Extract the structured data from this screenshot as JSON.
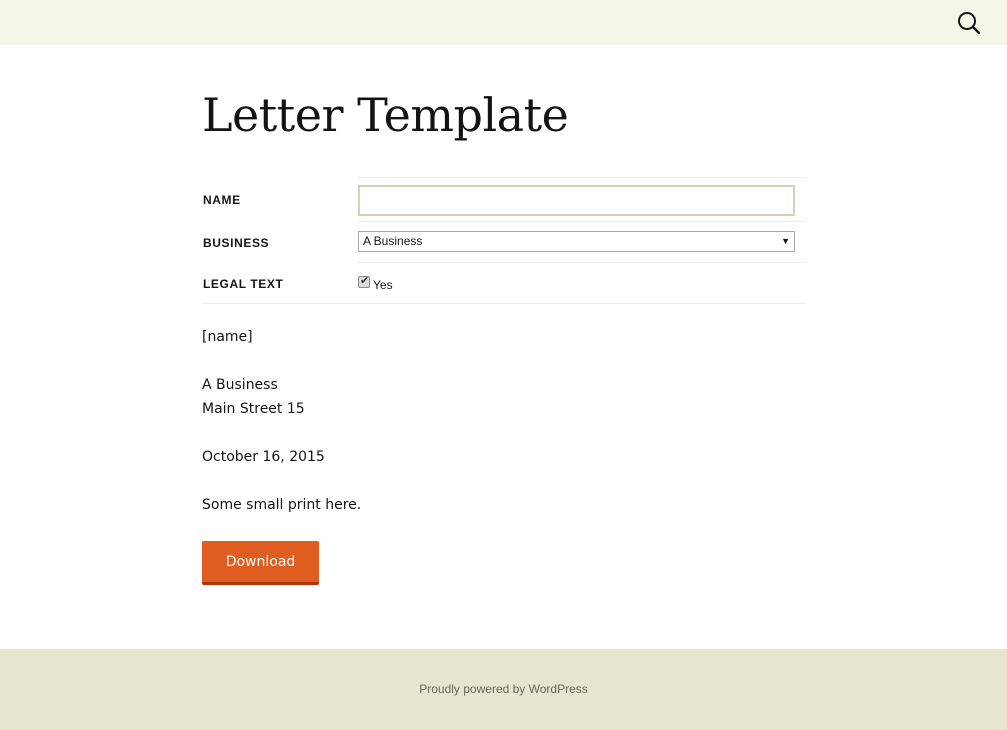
{
  "header": {
    "search_icon": "search-icon"
  },
  "page": {
    "title": "Letter Template"
  },
  "form": {
    "name": {
      "label": "NAME",
      "value": ""
    },
    "business": {
      "label": "BUSINESS",
      "selected": "A Business",
      "arrow": "▼"
    },
    "legal_text": {
      "label": "LEGAL TEXT",
      "checked": true,
      "option_label": "Yes",
      "tick": "✔"
    }
  },
  "letter": {
    "name_placeholder": "[name]",
    "business_name": "A Business",
    "address": "Main Street 15",
    "date": "October 16, 2015",
    "small_print": "Some small print here."
  },
  "actions": {
    "download_label": "Download"
  },
  "footer": {
    "credit": "Proudly powered by WordPress"
  },
  "colors": {
    "topbar": "#f7f5e7",
    "footer": "#e8e5ce",
    "button": "#e05d22",
    "button_shadow": "#b93207"
  }
}
